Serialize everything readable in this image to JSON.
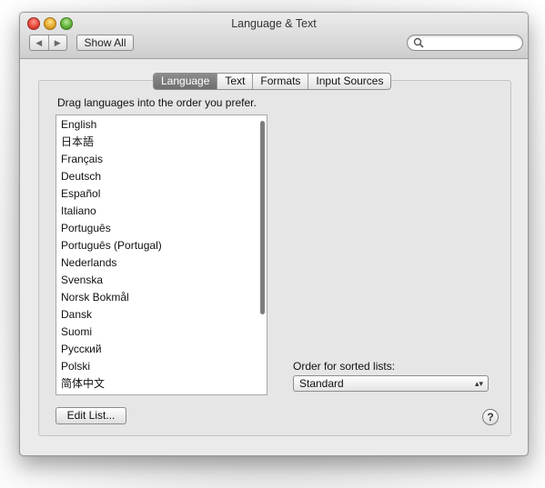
{
  "window": {
    "title": "Language & Text",
    "toolbar": {
      "back_glyph": "◀",
      "forward_glyph": "▶",
      "show_all_label": "Show All",
      "search_value": ""
    }
  },
  "tabs": [
    {
      "label": "Language",
      "selected": true
    },
    {
      "label": "Text",
      "selected": false
    },
    {
      "label": "Formats",
      "selected": false
    },
    {
      "label": "Input Sources",
      "selected": false
    }
  ],
  "language_pane": {
    "instruction": "Drag languages into the order you prefer.",
    "languages": [
      "English",
      "日本語",
      "Français",
      "Deutsch",
      "Español",
      "Italiano",
      "Português",
      "Português (Portugal)",
      "Nederlands",
      "Svenska",
      "Norsk Bokmål",
      "Dansk",
      "Suomi",
      "Русский",
      "Polski",
      "简体中文"
    ],
    "sorted_lists_label": "Order for sorted lists:",
    "sorted_lists_value": "Standard",
    "select_arrows_glyph": "▴▾",
    "edit_list_label": "Edit List...",
    "help_glyph": "?"
  }
}
